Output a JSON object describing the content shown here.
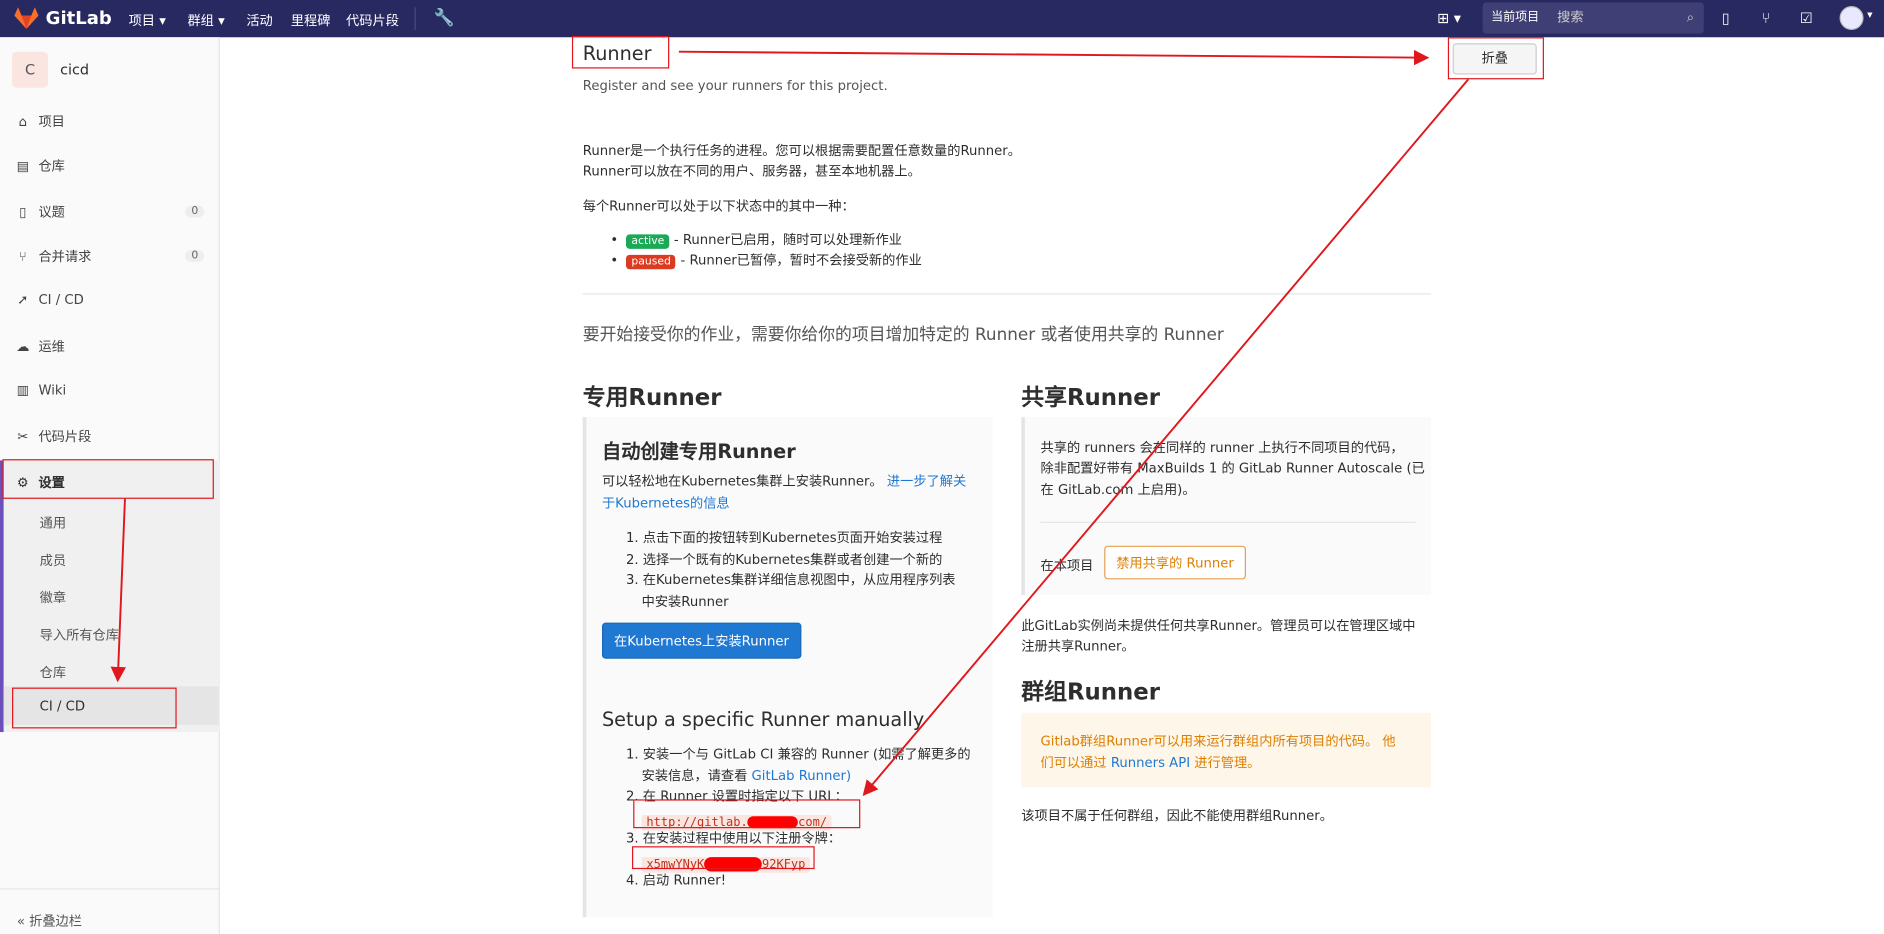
{
  "topbar": {
    "brand": "GitLab",
    "nav": [
      "项目",
      "群组",
      "活动",
      "里程碑",
      "代码片段"
    ],
    "scope": "当前项目",
    "search_placeholder": "搜索"
  },
  "sidebar": {
    "project_initial": "C",
    "project_name": "cicd",
    "items": [
      {
        "label": "项目"
      },
      {
        "label": "仓库"
      },
      {
        "label": "议题",
        "count": "0"
      },
      {
        "label": "合并请求",
        "count": "0"
      },
      {
        "label": "CI / CD"
      },
      {
        "label": "运维"
      },
      {
        "label": "Wiki"
      },
      {
        "label": "代码片段"
      },
      {
        "label": "设置"
      }
    ],
    "sub": [
      "通用",
      "成员",
      "徽章",
      "导入所有仓库",
      "仓库",
      "CI / CD"
    ],
    "collapse": "折叠边栏"
  },
  "main": {
    "title": "Runner",
    "subtitle": "Register and see your runners for this project.",
    "collapse_button": "折叠",
    "intro1": "Runner是一个执行任务的进程。您可以根据需要配置任意数量的Runner。",
    "intro2": "Runner可以放在不同的用户、服务器，甚至本地机器上。",
    "intro3": "每个Runner可以处于以下状态中的其中一种：",
    "active_badge": "active",
    "active_desc": "- Runner已启用，随时可以处理新作业",
    "paused_badge": "paused",
    "paused_desc": "- Runner已暂停，暂时不会接受新的作业",
    "lead": "要开始接受你的作业，需要你给你的项目增加特定的 Runner 或者使用共享的 Runner",
    "specific": {
      "heading": "专用Runner",
      "auto_heading": "自动创建专用Runner",
      "auto_desc": "可以轻松地在Kubernetes集群上安装Runner。",
      "learn_more_1": "进一步了解关",
      "learn_more_2": "于Kubernetes的信息",
      "steps": [
        "1. 点击下面的按钮转到Kubernetes页面开始安装过程",
        "2. 选择一个既有的Kubernetes集群或者创建一个新的",
        "3. 在Kubernetes集群详细信息视图中，从应用程序列表",
        "中安装Runner"
      ],
      "install_button": "在Kubernetes上安装Runner",
      "manual_heading": "Setup a specific Runner manually",
      "m1a": "1. 安装一个与 GitLab CI 兼容的 Runner (如需了解更多的",
      "m1b": "安装信息，请查看",
      "m1_link": "GitLab Runner)",
      "m2": "2. 在 Runner 设置时指定以下 URL：",
      "url": "http://gitlab.",
      "url_end": "com/",
      "m3": "3. 在安装过程中使用以下注册令牌：",
      "token_start": "x5mwYNyK",
      "token_end": "92KFyp",
      "m4": "4. 启动 Runner!"
    },
    "shared": {
      "heading": "共享Runner",
      "desc1": "共享的 runners 会在同样的 runner 上执行不同项目的代码，",
      "desc2": "除非配置好带有 MaxBuilds 1 的 GitLab Runner Autoscale (已",
      "desc3": "在 GitLab.com 上启用)。",
      "for_project": "在本项目",
      "disable_button": "禁用共享的 Runner",
      "note1": "此GitLab实例尚未提供任何共享Runner。管理员可以在管理区域中",
      "note2": "注册共享Runner。"
    },
    "group": {
      "heading": "群组Runner",
      "alert1": "Gitlab群组Runner可以用来运行群组内所有项目的代码。 他",
      "alert2a": "们可以通过",
      "alert2_link": "Runners API",
      "alert2b": "进行管理。",
      "note": "该项目不属于任何群组，因此不能使用群组Runner。"
    }
  },
  "colors": {
    "topbar": "#292961",
    "active": "#1aaa55",
    "paused": "#db3b21",
    "link": "#1f78d1",
    "annotation": "#e0171c"
  }
}
